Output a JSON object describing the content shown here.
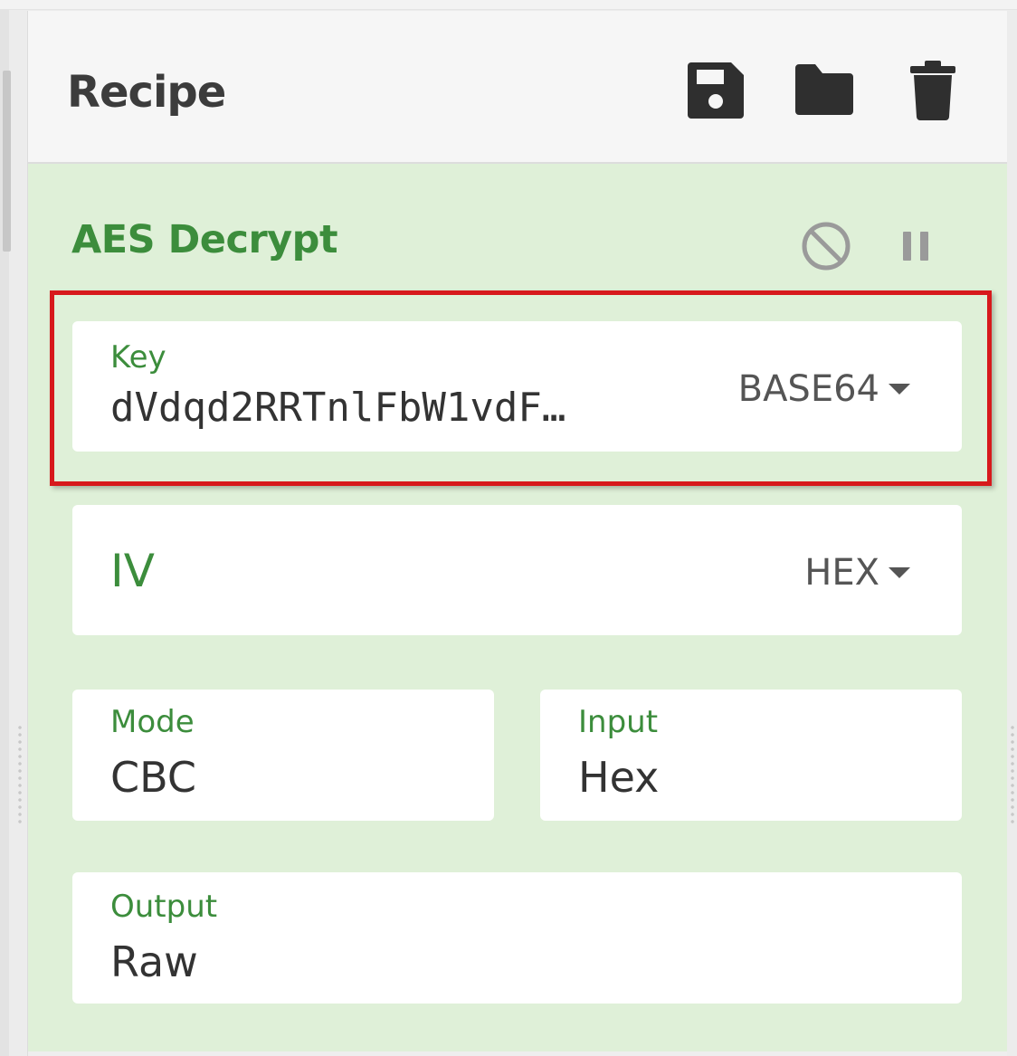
{
  "recipe": {
    "title": "Recipe",
    "icons": {
      "save": "save-icon",
      "load": "folder-icon",
      "clear": "trash-icon"
    }
  },
  "operation": {
    "title": "AES Decrypt",
    "icons": {
      "disable": "disable-icon",
      "pause": "pause-icon"
    },
    "key": {
      "label": "Key",
      "value": "dVdqd2RRTnlFbW1vdF…",
      "format": "BASE64"
    },
    "iv": {
      "label": "IV",
      "format": "HEX"
    },
    "mode": {
      "label": "Mode",
      "value": "CBC"
    },
    "input": {
      "label": "Input",
      "value": "Hex"
    },
    "output": {
      "label": "Output",
      "value": "Raw"
    }
  },
  "colors": {
    "panel_bg": "#dff0d8",
    "accent_green": "#3c8d3c",
    "highlight_red": "#d7191c"
  }
}
